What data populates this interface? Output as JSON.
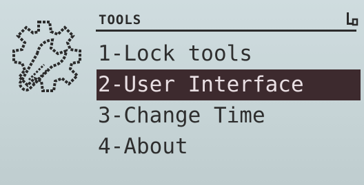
{
  "header": {
    "title": "TOOLS"
  },
  "icons": {
    "app_icon": "gear-wrench-icon",
    "status_icon": "key-icon"
  },
  "menu": {
    "items": [
      {
        "label": "1-Lock tools",
        "selected": false
      },
      {
        "label": "2-User Interface",
        "selected": true
      },
      {
        "label": "3-Change Time",
        "selected": false
      },
      {
        "label": "4-About",
        "selected": false
      }
    ]
  },
  "colors": {
    "screen_bg": "#c9d7d9",
    "ink": "#2b2b2b",
    "highlight_bg": "#3d2a2e",
    "highlight_text": "#e9dfe3"
  }
}
